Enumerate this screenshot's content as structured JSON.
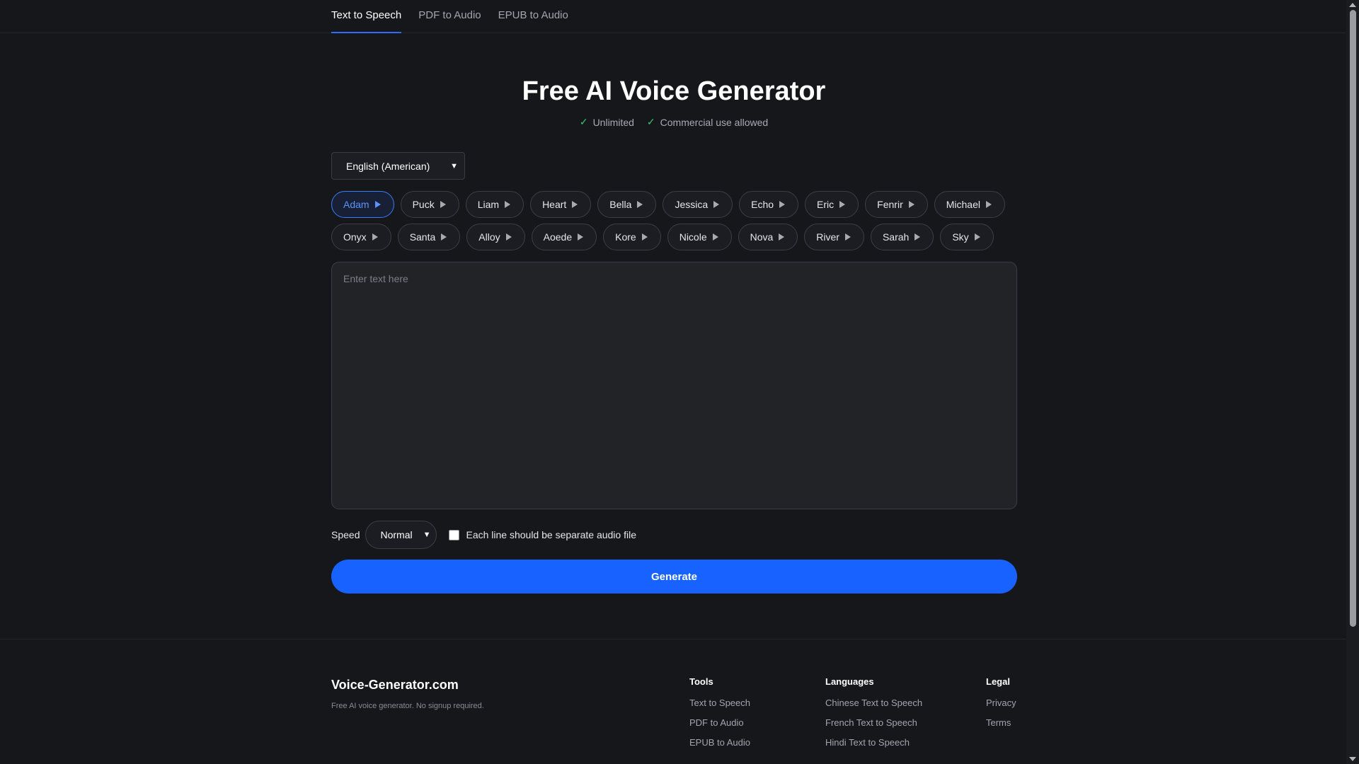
{
  "nav": {
    "tabs": [
      {
        "label": "Text to Speech",
        "active": true
      },
      {
        "label": "PDF to Audio",
        "active": false
      },
      {
        "label": "EPUB to Audio",
        "active": false
      }
    ]
  },
  "hero": {
    "title": "Free AI Voice Generator",
    "badges": [
      "Unlimited",
      "Commercial use allowed"
    ]
  },
  "language": {
    "selected": "English (American)"
  },
  "voices": {
    "selected": "Adam",
    "row1": [
      "Adam",
      "Puck",
      "Liam",
      "Heart",
      "Bella",
      "Jessica",
      "Echo",
      "Eric",
      "Fenrir",
      "Michael"
    ],
    "row2": [
      "Onyx",
      "Santa",
      "Alloy",
      "Aoede",
      "Kore",
      "Nicole",
      "Nova",
      "River",
      "Sarah",
      "Sky"
    ]
  },
  "editor": {
    "placeholder": "Enter text here",
    "value": ""
  },
  "options": {
    "speed_label": "Speed",
    "speed_value": "Normal",
    "split_label": "Each line should be separate audio file",
    "split_checked": false
  },
  "generate_label": "Generate",
  "footer": {
    "brand": "Voice-Generator.com",
    "tagline": "Free AI voice generator. No signup required.",
    "tools": {
      "title": "Tools",
      "links": [
        "Text to Speech",
        "PDF to Audio",
        "EPUB to Audio"
      ]
    },
    "languages": {
      "title": "Languages",
      "links": [
        "Chinese Text to Speech",
        "French Text to Speech",
        "Hindi Text to Speech"
      ]
    },
    "legal": {
      "title": "Legal",
      "links": [
        "Privacy",
        "Terms"
      ]
    }
  },
  "colors": {
    "accent": "#1863ff",
    "background": "#16171b",
    "check": "#3fc46a"
  },
  "icons": {
    "badge": "check-icon",
    "voice": "play-icon",
    "select": "chevron-down-icon"
  }
}
